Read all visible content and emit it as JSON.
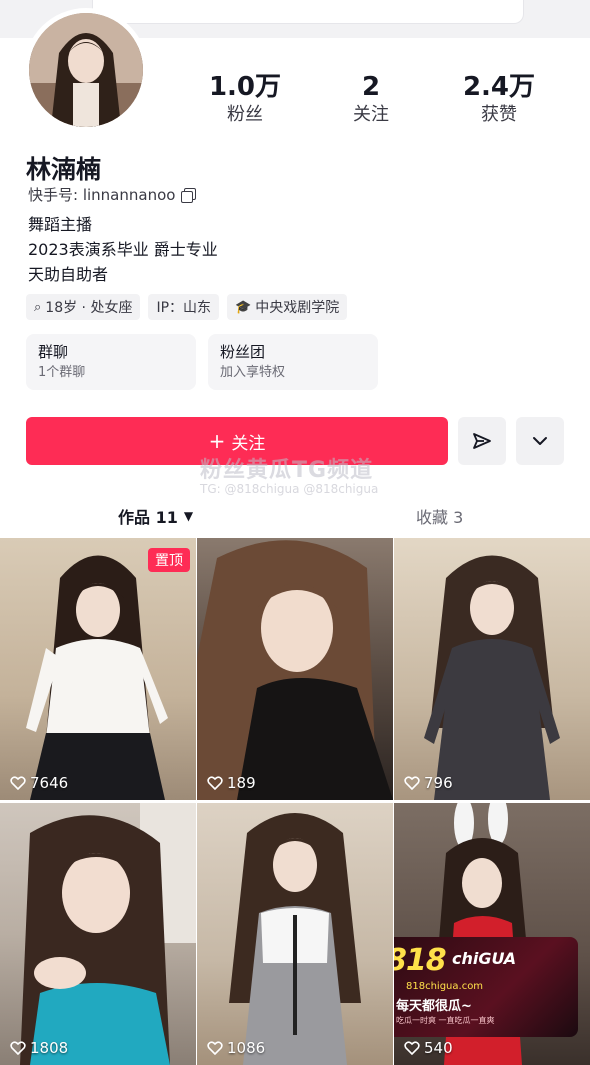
{
  "profile": {
    "followers_count": "1.0万",
    "followers_label": "粉丝",
    "following_count": "2",
    "following_label": "关注",
    "likes_count": "2.4万",
    "likes_label": "获赞",
    "name": "林湳楠",
    "kuaishou_id": "快手号: linnannanoo",
    "bio_lines": [
      "舞蹈主播",
      "2023表演系毕业 爵士专业",
      "天助自助者"
    ],
    "tags": [
      "18岁 · 处女座",
      "IP：山东",
      "中央戏剧学院"
    ]
  },
  "cards": [
    {
      "title": "群聊",
      "subtitle": "1个群聊"
    },
    {
      "title": "粉丝团",
      "subtitle": "加入享特权"
    }
  ],
  "actions": {
    "follow_label": "关注",
    "share_icon": "send-icon",
    "more_icon": "chevron-down-icon"
  },
  "watermark": {
    "line1": "粉丝黄瓜TG频道",
    "line2": "TG: @818chigua  @818chigua"
  },
  "tabs": [
    {
      "label": "作品 11",
      "active": true
    },
    {
      "label": "收藏 3",
      "active": false
    }
  ],
  "videos": [
    {
      "likes": "7646",
      "pinned": true,
      "pin_label": "置顶"
    },
    {
      "likes": "189",
      "pinned": false
    },
    {
      "likes": "796",
      "pinned": false
    },
    {
      "likes": "1808",
      "pinned": false
    },
    {
      "likes": "1086",
      "pinned": false
    },
    {
      "likes": "540",
      "pinned": false
    }
  ],
  "promo": {
    "number": "818",
    "brand": "chiGUA",
    "site": "818chigua.com",
    "slogan": "每天都很瓜~",
    "sub": "吃瓜一时爽 一直吃瓜一直爽"
  },
  "colors": {
    "accent": "#fe2c55",
    "text": "#161823",
    "muted": "#6b6b75"
  }
}
